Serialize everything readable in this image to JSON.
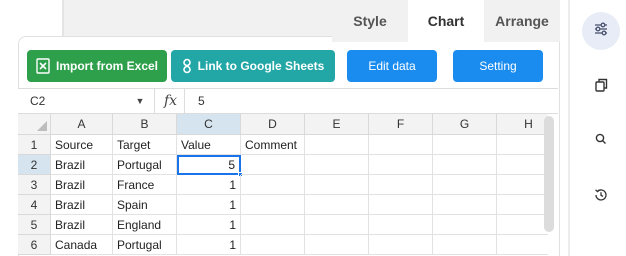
{
  "tabs": {
    "style": "Style",
    "chart": "Chart",
    "arrange": "Arrange"
  },
  "buttons": {
    "import_excel": "Import from Excel",
    "link_google": "Link to Google Sheets",
    "edit_data": "Edit data",
    "setting": "Setting"
  },
  "formula_bar": {
    "cell_ref": "C2",
    "fx_label": "fx",
    "value": "5"
  },
  "columns": [
    "A",
    "B",
    "C",
    "D",
    "E",
    "F",
    "G",
    "H"
  ],
  "rows": [
    {
      "num": "1",
      "cells": [
        "Source",
        "Target",
        "Value",
        "Comment"
      ]
    },
    {
      "num": "2",
      "cells": [
        "Brazil",
        "Portugal",
        "5",
        ""
      ]
    },
    {
      "num": "3",
      "cells": [
        "Brazil",
        "France",
        "1",
        ""
      ]
    },
    {
      "num": "4",
      "cells": [
        "Brazil",
        "Spain",
        "1",
        ""
      ]
    },
    {
      "num": "5",
      "cells": [
        "Brazil",
        "England",
        "1",
        ""
      ]
    },
    {
      "num": "6",
      "cells": [
        "Canada",
        "Portugal",
        "1",
        ""
      ]
    }
  ],
  "colors": {
    "excel_green": "#2e9f4b",
    "sheets_teal": "#22a6a6",
    "primary_blue": "#1a8cf0",
    "selection_blue": "#1a73e8"
  },
  "rail_icons": [
    "sliders-icon",
    "copy-icon",
    "search-icon",
    "history-icon"
  ]
}
